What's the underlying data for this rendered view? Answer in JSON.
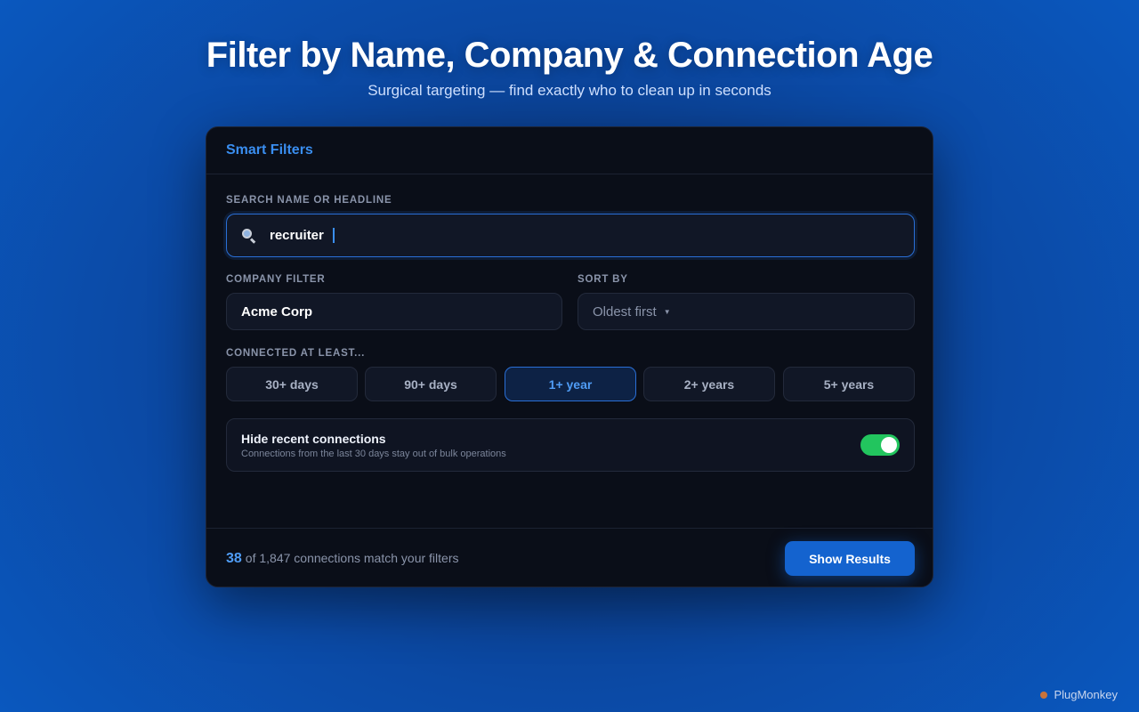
{
  "hero": {
    "title": "Filter by Name, Company & Connection Age",
    "subtitle": "Surgical targeting — find exactly who to clean up in seconds"
  },
  "panel": {
    "title": "Smart Filters",
    "search": {
      "label": "SEARCH NAME OR HEADLINE",
      "value": "recruiter",
      "icon": "search-icon"
    },
    "company": {
      "label": "COMPANY FILTER",
      "value": "Acme Corp"
    },
    "sort": {
      "label": "SORT BY",
      "value": "Oldest first"
    },
    "age": {
      "label": "CONNECTED AT LEAST...",
      "options": [
        "30+ days",
        "90+ days",
        "1+ year",
        "2+ years",
        "5+ years"
      ],
      "selected": "1+ year"
    },
    "toggle": {
      "title": "Hide recent connections",
      "description": "Connections from the last 30 days stay out of bulk operations",
      "enabled": true
    },
    "footer": {
      "count": "38",
      "text": "of 1,847 connections match your filters",
      "button": "Show Results"
    }
  },
  "brand": {
    "name": "PlugMonkey"
  },
  "colors": {
    "accent": "#1463cf",
    "toggle_on": "#22c55e",
    "panel_bg": "#0a0e18"
  }
}
